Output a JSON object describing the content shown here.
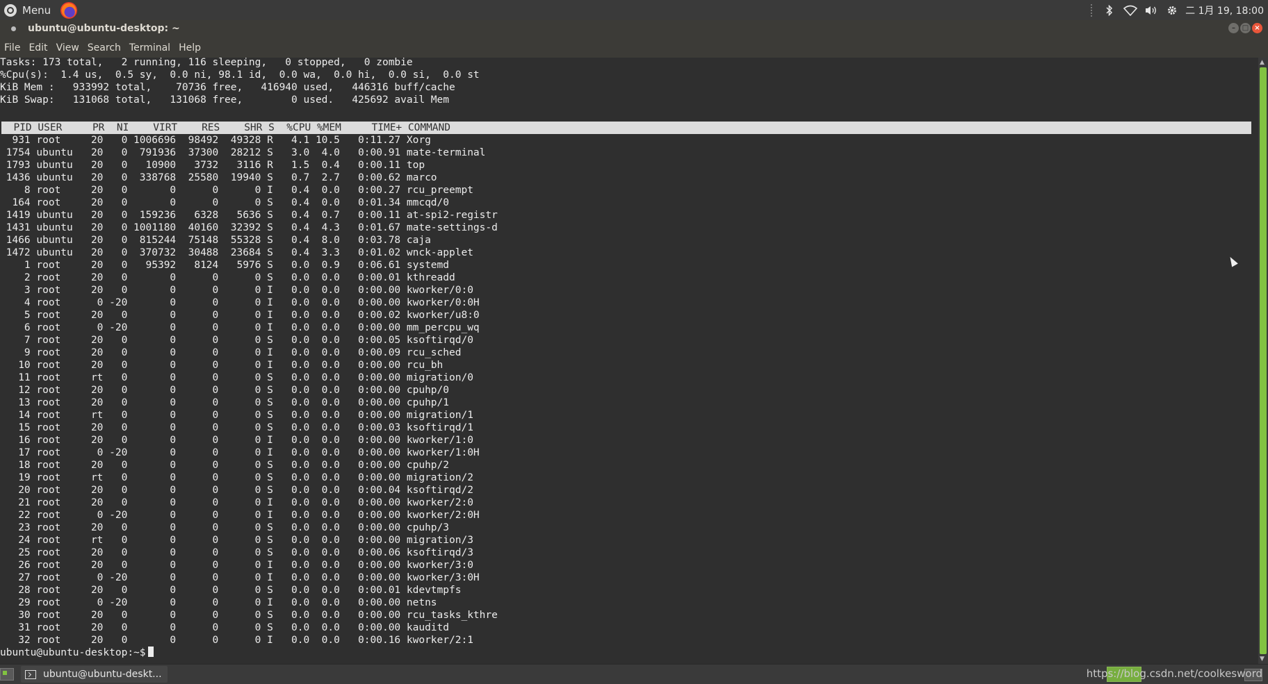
{
  "top_panel": {
    "menu_label": "Menu",
    "clock": "二 1月 19, 18:00",
    "icons": [
      "bluetooth-icon",
      "wifi-icon",
      "volume-icon",
      "settings-icon"
    ]
  },
  "window": {
    "title": "ubuntu@ubuntu-desktop: ~"
  },
  "menubar": {
    "items": [
      "File",
      "Edit",
      "View",
      "Search",
      "Terminal",
      "Help"
    ]
  },
  "terminal": {
    "summary": [
      "Tasks: 173 total,   2 running, 116 sleeping,   0 stopped,   0 zombie",
      "%Cpu(s):  1.4 us,  0.5 sy,  0.0 ni, 98.1 id,  0.0 wa,  0.0 hi,  0.0 si,  0.0 st",
      "KiB Mem :   933992 total,    70736 free,   416940 used,   446316 buff/cache",
      "KiB Swap:   131068 total,   131068 free,        0 used.   425692 avail Mem"
    ],
    "columns": [
      "PID",
      "USER",
      "PR",
      "NI",
      "VIRT",
      "RES",
      "SHR",
      "S",
      "%CPU",
      "%MEM",
      "TIME+",
      "COMMAND"
    ],
    "processes": [
      [
        "931",
        "root",
        "20",
        "0",
        "1006696",
        "98492",
        "49328",
        "R",
        "4.1",
        "10.5",
        "0:11.27",
        "Xorg"
      ],
      [
        "1754",
        "ubuntu",
        "20",
        "0",
        "791936",
        "37300",
        "28212",
        "S",
        "3.0",
        "4.0",
        "0:00.91",
        "mate-terminal"
      ],
      [
        "1793",
        "ubuntu",
        "20",
        "0",
        "10900",
        "3732",
        "3116",
        "R",
        "1.5",
        "0.4",
        "0:00.11",
        "top"
      ],
      [
        "1436",
        "ubuntu",
        "20",
        "0",
        "338768",
        "25580",
        "19940",
        "S",
        "0.7",
        "2.7",
        "0:00.62",
        "marco"
      ],
      [
        "8",
        "root",
        "20",
        "0",
        "0",
        "0",
        "0",
        "I",
        "0.4",
        "0.0",
        "0:00.27",
        "rcu_preempt"
      ],
      [
        "164",
        "root",
        "20",
        "0",
        "0",
        "0",
        "0",
        "S",
        "0.4",
        "0.0",
        "0:01.34",
        "mmcqd/0"
      ],
      [
        "1419",
        "ubuntu",
        "20",
        "0",
        "159236",
        "6328",
        "5636",
        "S",
        "0.4",
        "0.7",
        "0:00.11",
        "at-spi2-registr"
      ],
      [
        "1431",
        "ubuntu",
        "20",
        "0",
        "1001180",
        "40160",
        "32392",
        "S",
        "0.4",
        "4.3",
        "0:01.67",
        "mate-settings-d"
      ],
      [
        "1466",
        "ubuntu",
        "20",
        "0",
        "815244",
        "75148",
        "55328",
        "S",
        "0.4",
        "8.0",
        "0:03.78",
        "caja"
      ],
      [
        "1472",
        "ubuntu",
        "20",
        "0",
        "370732",
        "30488",
        "23684",
        "S",
        "0.4",
        "3.3",
        "0:01.02",
        "wnck-applet"
      ],
      [
        "1",
        "root",
        "20",
        "0",
        "95392",
        "8124",
        "5976",
        "S",
        "0.0",
        "0.9",
        "0:06.61",
        "systemd"
      ],
      [
        "2",
        "root",
        "20",
        "0",
        "0",
        "0",
        "0",
        "S",
        "0.0",
        "0.0",
        "0:00.01",
        "kthreadd"
      ],
      [
        "3",
        "root",
        "20",
        "0",
        "0",
        "0",
        "0",
        "I",
        "0.0",
        "0.0",
        "0:00.00",
        "kworker/0:0"
      ],
      [
        "4",
        "root",
        "0",
        "-20",
        "0",
        "0",
        "0",
        "I",
        "0.0",
        "0.0",
        "0:00.00",
        "kworker/0:0H"
      ],
      [
        "5",
        "root",
        "20",
        "0",
        "0",
        "0",
        "0",
        "I",
        "0.0",
        "0.0",
        "0:00.02",
        "kworker/u8:0"
      ],
      [
        "6",
        "root",
        "0",
        "-20",
        "0",
        "0",
        "0",
        "I",
        "0.0",
        "0.0",
        "0:00.00",
        "mm_percpu_wq"
      ],
      [
        "7",
        "root",
        "20",
        "0",
        "0",
        "0",
        "0",
        "S",
        "0.0",
        "0.0",
        "0:00.05",
        "ksoftirqd/0"
      ],
      [
        "9",
        "root",
        "20",
        "0",
        "0",
        "0",
        "0",
        "I",
        "0.0",
        "0.0",
        "0:00.09",
        "rcu_sched"
      ],
      [
        "10",
        "root",
        "20",
        "0",
        "0",
        "0",
        "0",
        "I",
        "0.0",
        "0.0",
        "0:00.00",
        "rcu_bh"
      ],
      [
        "11",
        "root",
        "rt",
        "0",
        "0",
        "0",
        "0",
        "S",
        "0.0",
        "0.0",
        "0:00.00",
        "migration/0"
      ],
      [
        "12",
        "root",
        "20",
        "0",
        "0",
        "0",
        "0",
        "S",
        "0.0",
        "0.0",
        "0:00.00",
        "cpuhp/0"
      ],
      [
        "13",
        "root",
        "20",
        "0",
        "0",
        "0",
        "0",
        "S",
        "0.0",
        "0.0",
        "0:00.00",
        "cpuhp/1"
      ],
      [
        "14",
        "root",
        "rt",
        "0",
        "0",
        "0",
        "0",
        "S",
        "0.0",
        "0.0",
        "0:00.00",
        "migration/1"
      ],
      [
        "15",
        "root",
        "20",
        "0",
        "0",
        "0",
        "0",
        "S",
        "0.0",
        "0.0",
        "0:00.03",
        "ksoftirqd/1"
      ],
      [
        "16",
        "root",
        "20",
        "0",
        "0",
        "0",
        "0",
        "I",
        "0.0",
        "0.0",
        "0:00.00",
        "kworker/1:0"
      ],
      [
        "17",
        "root",
        "0",
        "-20",
        "0",
        "0",
        "0",
        "I",
        "0.0",
        "0.0",
        "0:00.00",
        "kworker/1:0H"
      ],
      [
        "18",
        "root",
        "20",
        "0",
        "0",
        "0",
        "0",
        "S",
        "0.0",
        "0.0",
        "0:00.00",
        "cpuhp/2"
      ],
      [
        "19",
        "root",
        "rt",
        "0",
        "0",
        "0",
        "0",
        "S",
        "0.0",
        "0.0",
        "0:00.00",
        "migration/2"
      ],
      [
        "20",
        "root",
        "20",
        "0",
        "0",
        "0",
        "0",
        "S",
        "0.0",
        "0.0",
        "0:00.04",
        "ksoftirqd/2"
      ],
      [
        "21",
        "root",
        "20",
        "0",
        "0",
        "0",
        "0",
        "I",
        "0.0",
        "0.0",
        "0:00.00",
        "kworker/2:0"
      ],
      [
        "22",
        "root",
        "0",
        "-20",
        "0",
        "0",
        "0",
        "I",
        "0.0",
        "0.0",
        "0:00.00",
        "kworker/2:0H"
      ],
      [
        "23",
        "root",
        "20",
        "0",
        "0",
        "0",
        "0",
        "S",
        "0.0",
        "0.0",
        "0:00.00",
        "cpuhp/3"
      ],
      [
        "24",
        "root",
        "rt",
        "0",
        "0",
        "0",
        "0",
        "S",
        "0.0",
        "0.0",
        "0:00.00",
        "migration/3"
      ],
      [
        "25",
        "root",
        "20",
        "0",
        "0",
        "0",
        "0",
        "S",
        "0.0",
        "0.0",
        "0:00.06",
        "ksoftirqd/3"
      ],
      [
        "26",
        "root",
        "20",
        "0",
        "0",
        "0",
        "0",
        "I",
        "0.0",
        "0.0",
        "0:00.00",
        "kworker/3:0"
      ],
      [
        "27",
        "root",
        "0",
        "-20",
        "0",
        "0",
        "0",
        "I",
        "0.0",
        "0.0",
        "0:00.00",
        "kworker/3:0H"
      ],
      [
        "28",
        "root",
        "20",
        "0",
        "0",
        "0",
        "0",
        "S",
        "0.0",
        "0.0",
        "0:00.01",
        "kdevtmpfs"
      ],
      [
        "29",
        "root",
        "0",
        "-20",
        "0",
        "0",
        "0",
        "I",
        "0.0",
        "0.0",
        "0:00.00",
        "netns"
      ],
      [
        "30",
        "root",
        "20",
        "0",
        "0",
        "0",
        "0",
        "S",
        "0.0",
        "0.0",
        "0:00.00",
        "rcu_tasks_kthre"
      ],
      [
        "31",
        "root",
        "20",
        "0",
        "0",
        "0",
        "0",
        "S",
        "0.0",
        "0.0",
        "0:00.00",
        "kauditd"
      ],
      [
        "32",
        "root",
        "20",
        "0",
        "0",
        "0",
        "0",
        "I",
        "0.0",
        "0.0",
        "0:00.16",
        "kworker/2:1"
      ]
    ],
    "prompt": "ubuntu@ubuntu-desktop:~$"
  },
  "bottom_panel": {
    "task_label": "ubuntu@ubuntu-deskt...",
    "watermark": "https://blog.csdn.net/coolkesword"
  },
  "colors": {
    "terminal_bg": "#2f2f2f",
    "terminal_fg": "#ececec",
    "header_bg": "#dcdcdc",
    "accent_green": "#82c341",
    "close_orange": "#e9563a"
  }
}
